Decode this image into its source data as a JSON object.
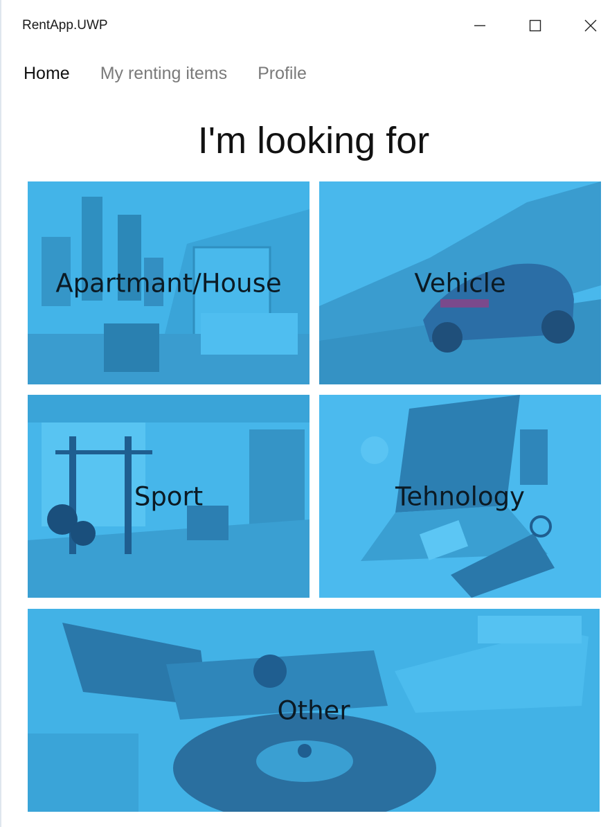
{
  "window": {
    "title": "RentApp.UWP",
    "controls": {
      "minimize_icon": "minimize-icon",
      "maximize_icon": "maximize-icon",
      "close_icon": "close-icon"
    }
  },
  "nav": {
    "items": [
      {
        "label": "Home",
        "active": true
      },
      {
        "label": "My renting items",
        "active": false
      },
      {
        "label": "Profile",
        "active": false
      }
    ]
  },
  "main": {
    "heading": "I'm looking for",
    "categories": [
      {
        "label": "Apartmant/House",
        "image": "city-apartment-photo"
      },
      {
        "label": "Vehicle",
        "image": "sports-car-photo"
      },
      {
        "label": "Sport",
        "image": "home-gym-photo"
      },
      {
        "label": "Tehnology",
        "image": "laptop-desk-photo"
      },
      {
        "label": "Other",
        "image": "tools-closeup-photo"
      }
    ]
  },
  "colors": {
    "tile_overlay": "#3fb2e6",
    "accent": "#2aa6e0",
    "nav_active": "#111111",
    "nav_inactive": "#7a7a7a"
  }
}
